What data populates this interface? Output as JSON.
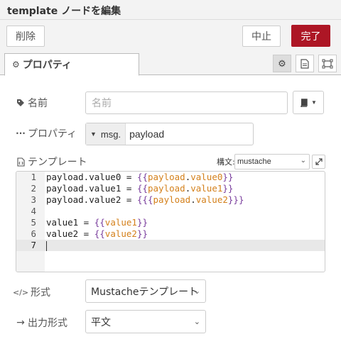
{
  "dialog": {
    "title": "template ノードを編集"
  },
  "toolbar": {
    "delete_label": "削除",
    "cancel_label": "中止",
    "done_label": "完了"
  },
  "tabs": {
    "properties_label": "プロパティ"
  },
  "fields": {
    "name": {
      "label": "名前",
      "placeholder": "名前",
      "value": ""
    },
    "property": {
      "label": "プロパティ",
      "prefix": "msg.",
      "value": "payload"
    },
    "template": {
      "label": "テンプレート",
      "syntax_label": "構文:",
      "syntax_value": "mustache"
    },
    "format": {
      "label": "形式",
      "value": "Mustacheテンプレート"
    },
    "output": {
      "label": "出力形式",
      "value": "平文"
    }
  },
  "editor": {
    "line_numbers": [
      "1",
      "2",
      "3",
      "4",
      "5",
      "6",
      "7"
    ],
    "lines": [
      "payload.value0 = {{payload.value0}}",
      "payload.value1 = {{payload.value1}}",
      "payload.value2 = {{{payload.value2}}}",
      "",
      "value1 = {{value1}}",
      "value2 = {{value2}}",
      ""
    ],
    "active_line": 7
  },
  "colors": {
    "done_button": "#ad1625",
    "mustache_brace": "#7a3e9d",
    "mustache_var": "#d4801b"
  }
}
